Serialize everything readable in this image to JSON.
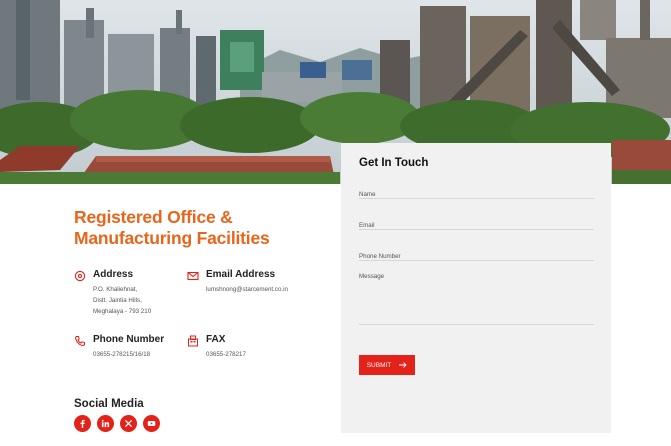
{
  "brand": {
    "accent": "#e8651b",
    "button": "#e32219",
    "card_bg": "#f1f1f1"
  },
  "hero": {
    "image": "industrial-plant-photo"
  },
  "office": {
    "heading": "Registered Office & Manufacturing Facilities",
    "address": {
      "icon": "location-icon",
      "title": "Address",
      "lines": [
        "P.O. Khaliehnat,",
        "Distt. Jaintia Hills,",
        "Meghalaya - 793 210"
      ]
    },
    "email": {
      "icon": "mail-icon",
      "title": "Email Address",
      "value": "lumshnong@starcement.co.in"
    },
    "phone": {
      "icon": "phone-icon",
      "title": "Phone Number",
      "value": "03655-278215/16/18"
    },
    "fax": {
      "icon": "fax-icon",
      "title": "FAX",
      "value": "03655-278217"
    }
  },
  "social": {
    "title": "Social Media",
    "icons": [
      "facebook-icon",
      "linkedin-icon",
      "x-icon",
      "youtube-icon"
    ]
  },
  "form": {
    "title": "Get In Touch",
    "name_placeholder": "Name",
    "email_placeholder": "Email",
    "phone_placeholder": "Phone Number",
    "message_placeholder": "Message",
    "submit_label": "SUBMIT",
    "submit_icon": "arrow-right-icon"
  }
}
